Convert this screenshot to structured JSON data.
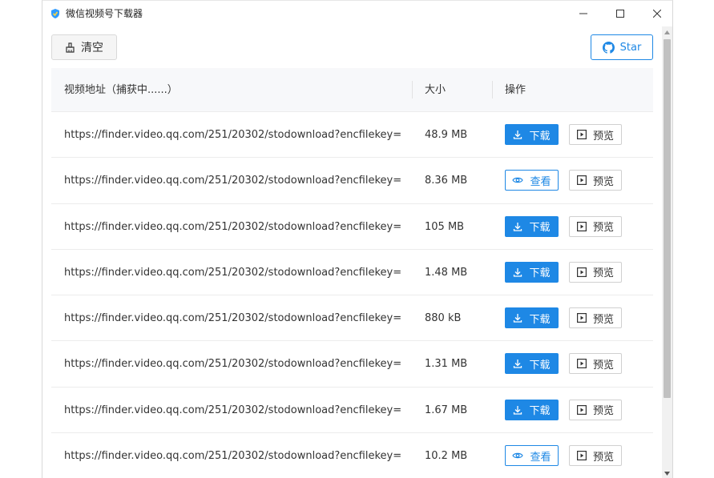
{
  "window": {
    "title": "微信视频号下载器"
  },
  "toolbar": {
    "clear_label": "清空",
    "star_label": "Star"
  },
  "table": {
    "headers": {
      "url": "视频地址（捕获中......）",
      "size": "大小",
      "action": "操作"
    },
    "labels": {
      "download": "下载",
      "view": "查看",
      "preview": "预览"
    },
    "rows": [
      {
        "url": "https://finder.video.qq.com/251/20302/stodownload?encfilekey=...",
        "size": "48.9 MB",
        "action": "download"
      },
      {
        "url": "https://finder.video.qq.com/251/20302/stodownload?encfilekey=...",
        "size": "8.36 MB",
        "action": "view"
      },
      {
        "url": "https://finder.video.qq.com/251/20302/stodownload?encfilekey=...",
        "size": "105 MB",
        "action": "download"
      },
      {
        "url": "https://finder.video.qq.com/251/20302/stodownload?encfilekey=...",
        "size": "1.48 MB",
        "action": "download"
      },
      {
        "url": "https://finder.video.qq.com/251/20302/stodownload?encfilekey=...",
        "size": "880 kB",
        "action": "download"
      },
      {
        "url": "https://finder.video.qq.com/251/20302/stodownload?encfilekey=...",
        "size": "1.31 MB",
        "action": "download"
      },
      {
        "url": "https://finder.video.qq.com/251/20302/stodownload?encfilekey=...",
        "size": "1.67 MB",
        "action": "download"
      },
      {
        "url": "https://finder.video.qq.com/251/20302/stodownload?encfilekey=...",
        "size": "10.2 MB",
        "action": "view"
      }
    ]
  },
  "colors": {
    "primary": "#1e88e5",
    "header_bg": "#f7f8fa",
    "border": "#ececec"
  },
  "icons": {
    "app": "shield-logo-icon",
    "clear": "broom-icon",
    "star": "github-icon",
    "download": "download-icon",
    "view": "eye-icon",
    "preview": "play-square-icon"
  }
}
